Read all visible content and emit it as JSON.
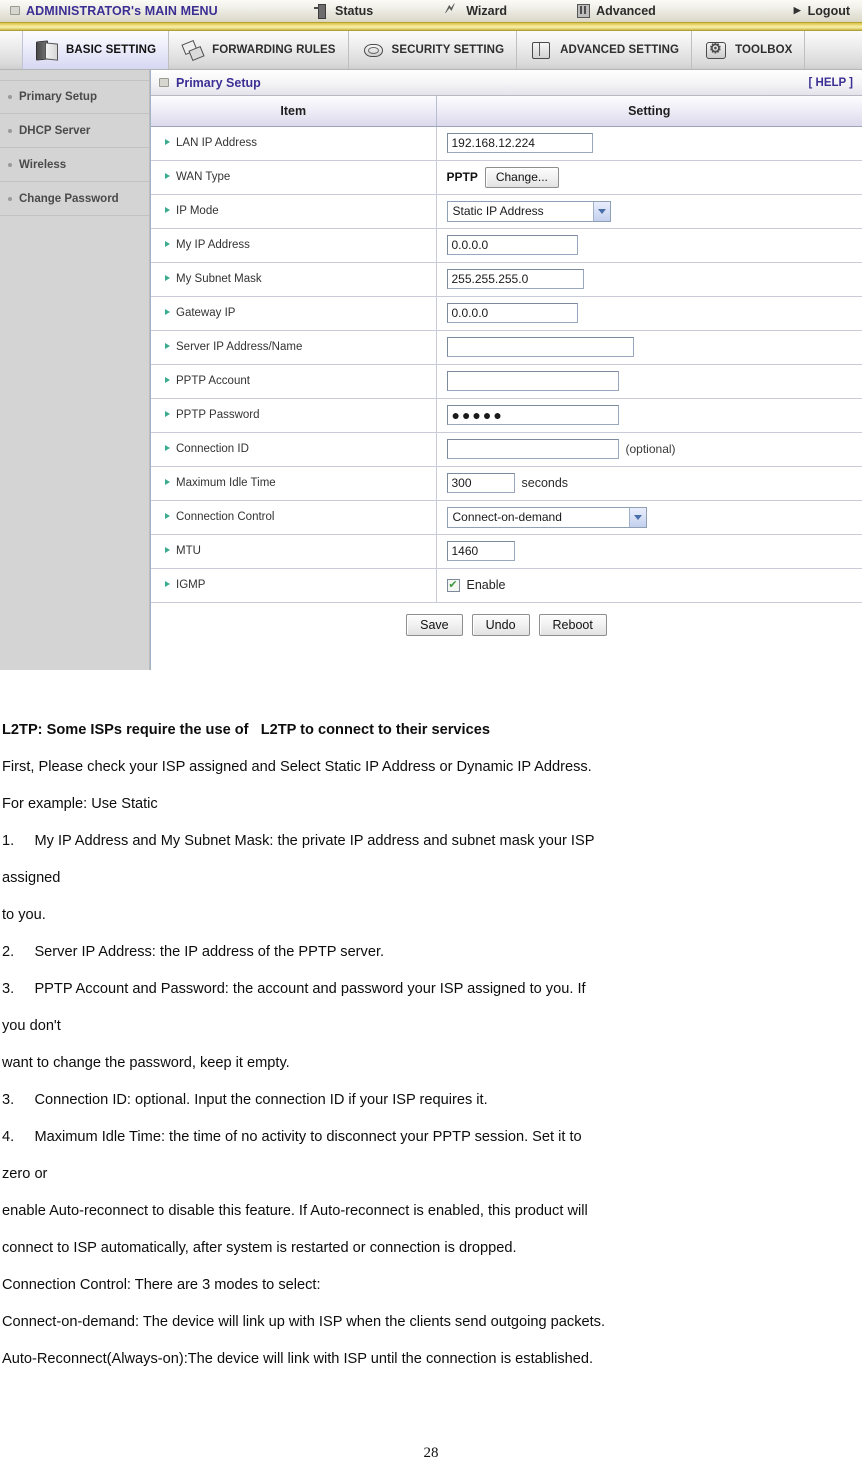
{
  "topbar": {
    "admin_title": "ADMINISTRATOR's MAIN MENU",
    "status": "Status",
    "wizard": "Wizard",
    "advanced": "Advanced",
    "logout": "Logout"
  },
  "tabs": [
    {
      "label": "BASIC SETTING",
      "icon": "books-icon",
      "active": true
    },
    {
      "label": "FORWARDING RULES",
      "icon": "forwarding-arrows-icon",
      "active": false
    },
    {
      "label": "SECURITY SETTING",
      "icon": "shield-hex-icon",
      "active": false
    },
    {
      "label": "ADVANCED SETTING",
      "icon": "book-icon",
      "active": false
    },
    {
      "label": "TOOLBOX",
      "icon": "gear-toolbox-icon",
      "active": false
    }
  ],
  "sidebar": {
    "items": [
      {
        "label": "Primary Setup"
      },
      {
        "label": "DHCP Server"
      },
      {
        "label": "Wireless"
      },
      {
        "label": "Change Password"
      }
    ]
  },
  "panel": {
    "title": "Primary Setup",
    "help": "[ HELP ]",
    "columns": {
      "item": "Item",
      "setting": "Setting"
    },
    "rows": {
      "lan_ip": {
        "label": "LAN IP Address",
        "value": "192.168.12.224"
      },
      "wan_type": {
        "label": "WAN Type",
        "value": "PPTP",
        "button": "Change..."
      },
      "ip_mode": {
        "label": "IP Mode",
        "value": "Static IP Address"
      },
      "my_ip": {
        "label": "My IP Address",
        "value": "0.0.0.0"
      },
      "my_subnet": {
        "label": "My Subnet Mask",
        "value": "255.255.255.0"
      },
      "gateway_ip": {
        "label": "Gateway IP",
        "value": "0.0.0.0"
      },
      "server_ip": {
        "label": "Server IP Address/Name",
        "value": ""
      },
      "pptp_account": {
        "label": "PPTP Account",
        "value": ""
      },
      "pptp_password": {
        "label": "PPTP Password",
        "value": "●●●●●"
      },
      "connection_id": {
        "label": "Connection ID",
        "value": "",
        "hint": "(optional)"
      },
      "max_idle": {
        "label": "Maximum Idle Time",
        "value": "300",
        "unit": "seconds"
      },
      "conn_control": {
        "label": "Connection Control",
        "value": "Connect-on-demand"
      },
      "mtu": {
        "label": "MTU",
        "value": "1460"
      },
      "igmp": {
        "label": "IGMP",
        "checkbox_label": "Enable",
        "checked": true
      }
    },
    "buttons": {
      "save": "Save",
      "undo": "Undo",
      "reboot": "Reboot"
    }
  },
  "document": {
    "lines": [
      {
        "text": "L2TP: Some ISPs require the use of   L2TP to connect to their services",
        "bold": true
      },
      {
        "text": "First, Please check your ISP assigned and Select Static IP Address or Dynamic IP Address.",
        "bold": false
      },
      {
        "text": "For example: Use Static",
        "bold": false
      },
      {
        "text": "1.     My IP Address and My Subnet Mask: the private IP address and subnet mask your ISP",
        "bold": false
      },
      {
        "text": "assigned",
        "bold": false
      },
      {
        "text": "to you.",
        "bold": false
      },
      {
        "text": "2.     Server IP Address: the IP address of the PPTP server.",
        "bold": false
      },
      {
        "text": "3.     PPTP Account and Password: the account and password your ISP assigned to you. If",
        "bold": false
      },
      {
        "text": "you don't",
        "bold": false
      },
      {
        "text": "want to change the password, keep it empty.",
        "bold": false
      },
      {
        "text": "3.     Connection ID: optional. Input the connection ID if your ISP requires it.",
        "bold": false
      },
      {
        "text": "4.     Maximum Idle Time: the time of no activity to disconnect your PPTP session. Set it to",
        "bold": false
      },
      {
        "text": "zero or",
        "bold": false
      },
      {
        "text": "enable Auto-reconnect to disable this feature. If Auto-reconnect is enabled, this product will",
        "bold": false
      },
      {
        "text": "connect to ISP automatically, after system is restarted or connection is dropped.",
        "bold": false
      },
      {
        "text": "Connection Control: There are 3 modes to select:",
        "bold": false
      },
      {
        "text": "Connect-on-demand: The device will link up with ISP when the clients send outgoing packets.",
        "bold": false
      },
      {
        "text": "Auto-Reconnect(Always-on):The device will link with ISP until the connection is established.",
        "bold": false
      }
    ],
    "page_number": "28"
  }
}
